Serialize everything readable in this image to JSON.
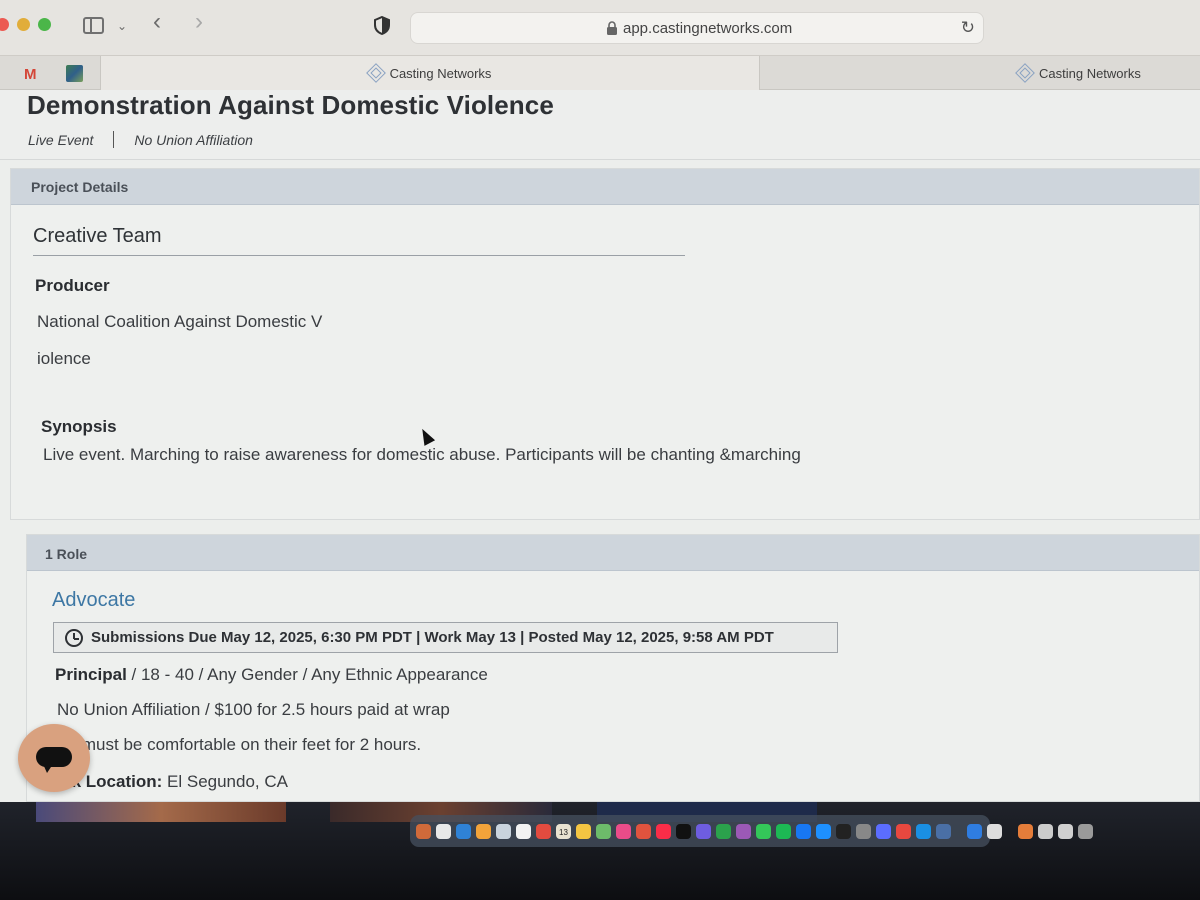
{
  "browser": {
    "url": "app.castingnetworks.com",
    "tabs": [
      {
        "label": "Casting Networks"
      },
      {
        "label": "Casting Networks"
      }
    ],
    "pinned_tab_gmail": "M"
  },
  "project": {
    "title": "Demonstration Against Domestic Violence",
    "type": "Live Event",
    "union": "No Union Affiliation"
  },
  "details": {
    "section_label": "Project Details",
    "creative_team_heading": "Creative Team",
    "producer_label": "Producer",
    "producer_line1": "National Coalition Against Domestic V",
    "producer_line2": "iolence",
    "synopsis_label": "Synopsis",
    "synopsis_text": "Live event.  Marching to raise awareness for domestic abuse.  Participants will be chanting &marching"
  },
  "roles": {
    "section_label": "1 Role",
    "items": [
      {
        "name": "Advocate",
        "dates": "Submissions Due May 12, 2025, 6:30 PM PDT | Work May 13 | Posted May 12, 2025, 9:58 AM PDT",
        "role_type": "Principal",
        "demographics": " / 18 - 40 / Any Gender / Any Ethnic Appearance",
        "pay": "No Union Affiliation / $100 for 2.5 hours paid at wrap",
        "note": "nt must be comfortable on their feet for 2 hours.",
        "location_label": "rk Location:",
        "location_value": " El Segundo, CA"
      }
    ]
  },
  "dock": {
    "calendar_day": "13",
    "icon_colors": [
      "#d06a3a",
      "#e8e8e8",
      "#2f82d6",
      "#f2a33a",
      "#c9d3dd",
      "#f2f2f2",
      "#e34b3f",
      "#e9e2d0",
      "#f4c542",
      "#6dbb6a",
      "#ea4c89",
      "#e0533e",
      "#fa2d48",
      "#111111",
      "#6e5de0",
      "#2ba24c",
      "#9b59b6",
      "#34c759",
      "#1db954",
      "#1877f2",
      "#1e90ff",
      "#222222",
      "#888888",
      "#5b6dff",
      "#e8483f",
      "#1a8fe3",
      "#4a6fa5",
      "#2f7de1",
      "#dddddd",
      "#e57d3a",
      "#cccccc",
      "#d0d0d0",
      "#9a9a9a"
    ]
  }
}
